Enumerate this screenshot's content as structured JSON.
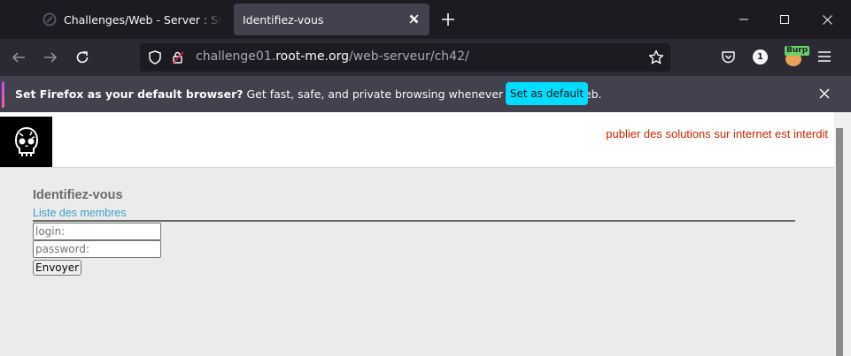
{
  "tabs": [
    {
      "title": "Challenges/Web - Server : SQL injection",
      "active": false
    },
    {
      "title": "Identifiez-vous",
      "active": true
    }
  ],
  "icons": {
    "new_tab": "plus-icon",
    "minimize": "minimize-icon",
    "maximize": "maximize-icon",
    "close": "close-icon",
    "back": "back-arrow-icon",
    "forward": "forward-arrow-icon",
    "reload": "reload-icon",
    "shield": "shield-icon",
    "lock": "insecure-lock-icon",
    "bookmark": "star-icon",
    "pocket": "pocket-icon",
    "menu": "hamburger-menu-icon"
  },
  "urlbar": {
    "prefix": "challenge01.",
    "domain": "root-me.org",
    "path": "/web-serveur/ch42/"
  },
  "extensions": {
    "downloads_badge": "1",
    "burp_label": "Burp"
  },
  "notification": {
    "bold": "Set Firefox as your default browser?",
    "text": " Get fast, safe, and private browsing whenever you use the web.",
    "button_label": "Set as default"
  },
  "page": {
    "warning": "publier des solutions sur internet est interdit",
    "heading": "Identifiez-vous",
    "members_link": "Liste des membres",
    "login_placeholder": "login:",
    "password_placeholder": "password:",
    "submit_label": "Envoyer"
  },
  "colors": {
    "accent": "#00ddff",
    "warning": "#cc2200",
    "link": "#3fa0c8"
  }
}
